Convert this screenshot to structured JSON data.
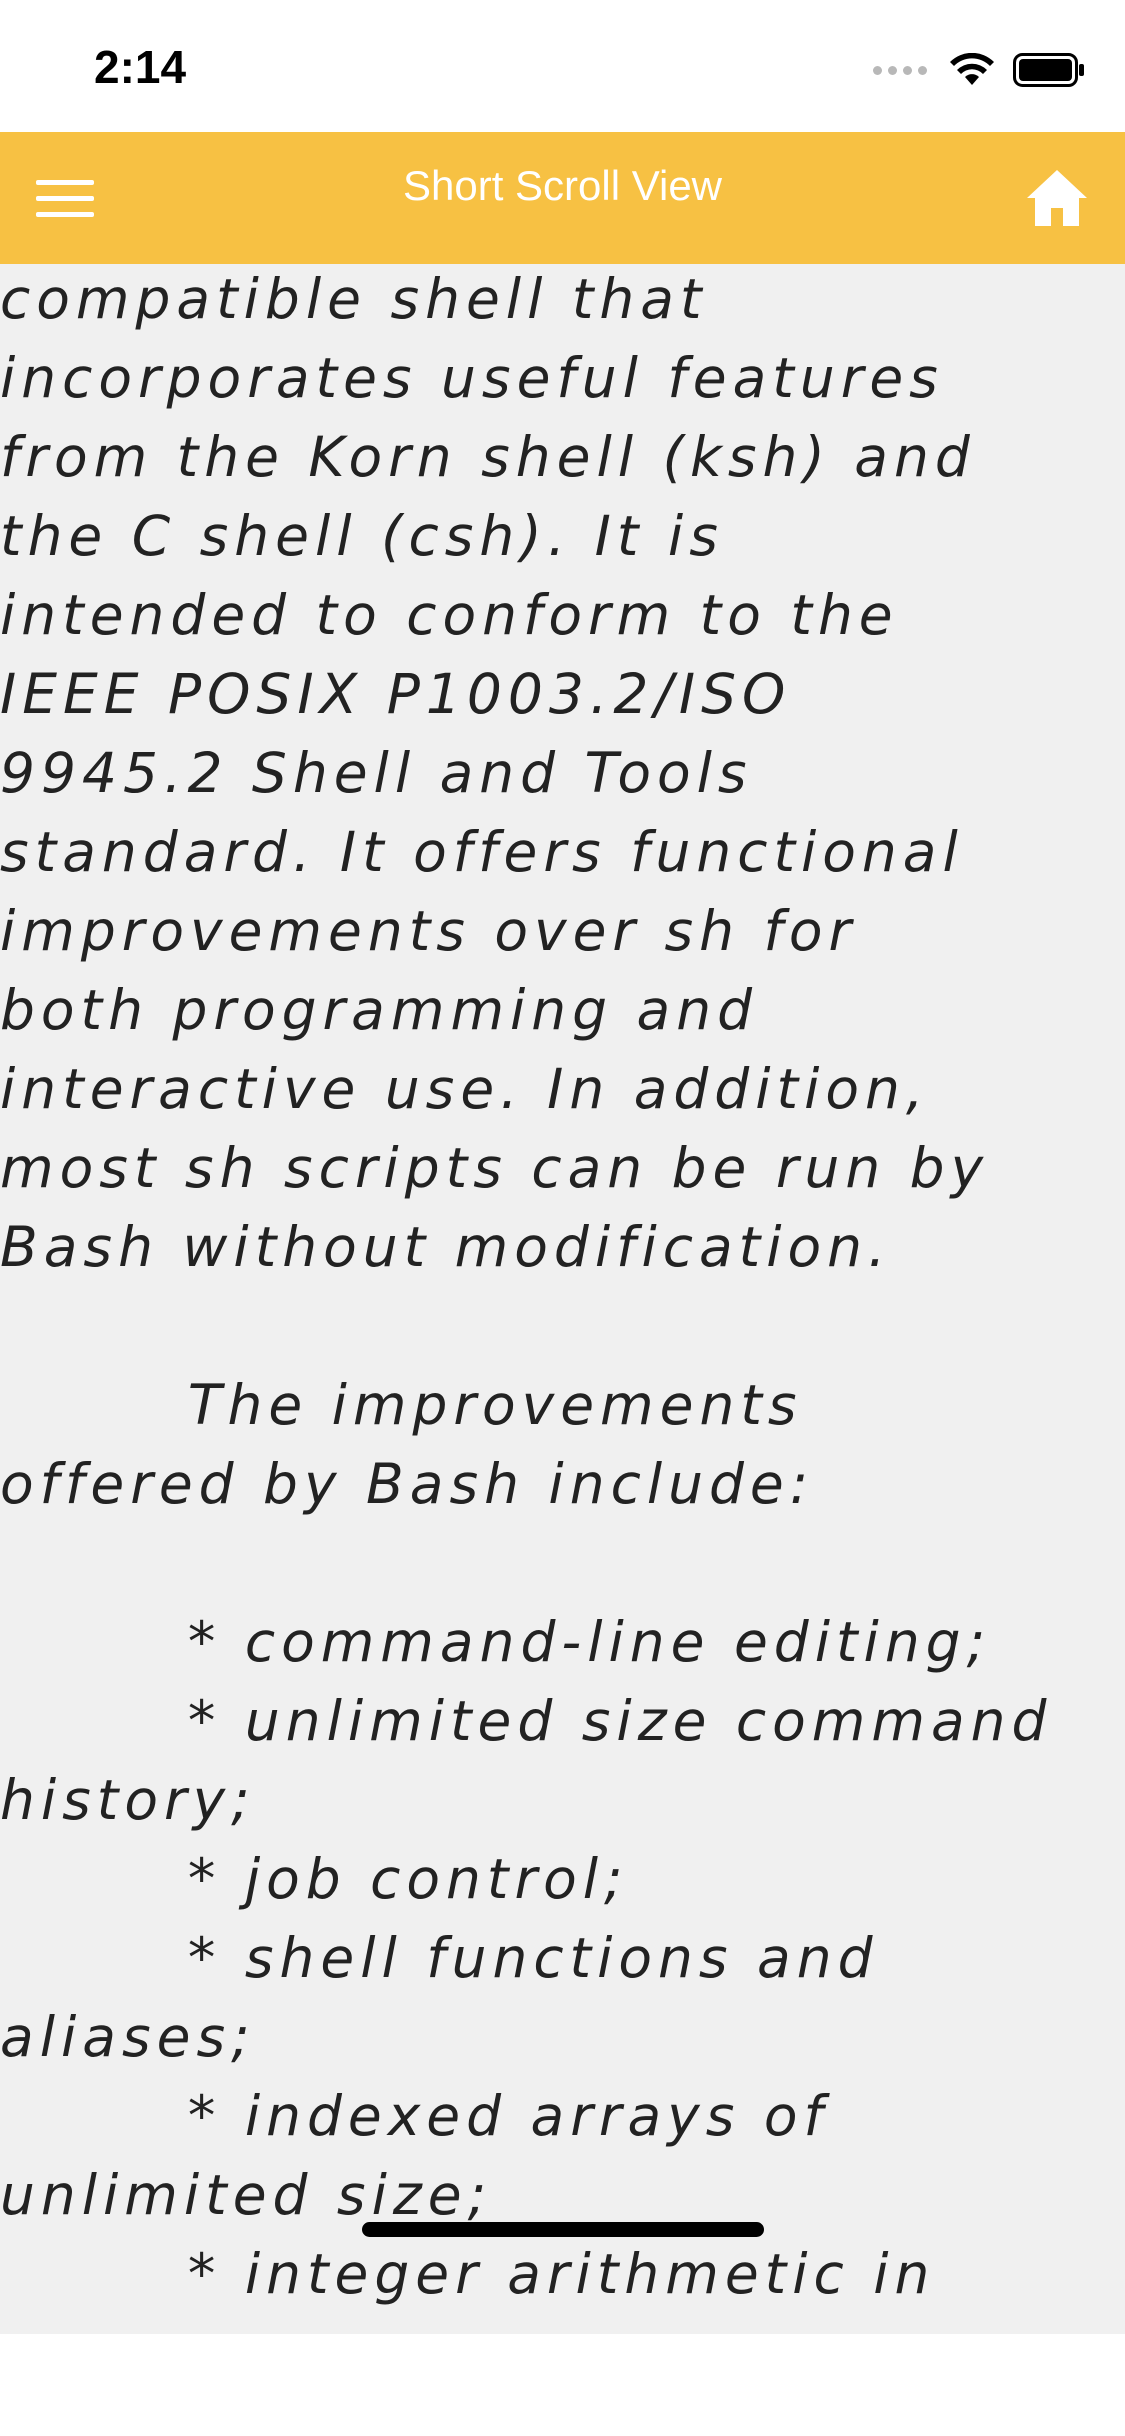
{
  "status_bar": {
    "time": "2:14"
  },
  "nav_bar": {
    "title": "Short Scroll View",
    "background_color": "#f7c143",
    "menu_icon": "hamburger-menu-icon",
    "home_icon": "home-icon"
  },
  "content": {
    "background_color": "#f0f0f0",
    "text": "compatible shell that\nincorporates useful features\nfrom the Korn shell (ksh) and\nthe C shell (csh). It is\nintended to conform to the\nIEEE POSIX P1003.2/ISO\n9945.2 Shell and Tools\nstandard. It offers functional\nimprovements over sh for\nboth programming and\ninteractive use. In addition,\nmost sh scripts can be run by\nBash without modification.\n\n        The improvements\noffered by Bash include:\n\n        * command-line editing;\n        * unlimited size command\nhistory;\n        * job control;\n        * shell functions and\naliases;\n        * indexed arrays of\nunlimited size;\n        * integer arithmetic in"
  }
}
